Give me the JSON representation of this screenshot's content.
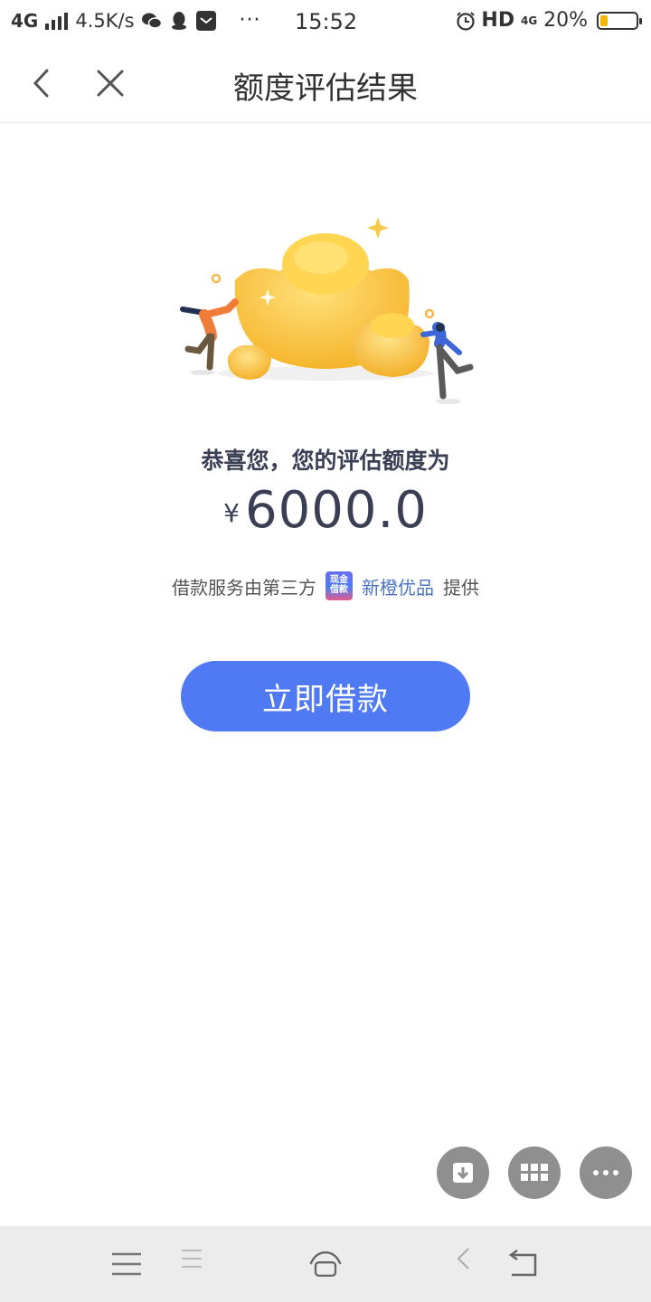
{
  "status_bar": {
    "network": "4G",
    "speed": "4.5K/s",
    "dots": "···",
    "time": "15:52",
    "hd": "HD",
    "net_small": "4G",
    "battery_text": "20%",
    "battery_level": 0.2
  },
  "nav": {
    "title": "额度评估结果"
  },
  "result": {
    "headline": "恭喜您，您的评估额度为",
    "currency": "¥",
    "amount": "6000.0"
  },
  "provider": {
    "prefix": "借款服务由第三方",
    "logo_text": "现金借款",
    "name": "新橙优品",
    "suffix": "提供"
  },
  "cta": {
    "label": "立即借款"
  },
  "colors": {
    "accent": "#4f7af3",
    "text_dark": "#3a3f55",
    "provider_link": "#4a73c9",
    "fab": "#8f8f8f"
  },
  "icons": [
    "back-icon",
    "close-icon",
    "download-icon",
    "grid-icon",
    "more-icon",
    "menu-icon",
    "home-icon",
    "back-nav-icon",
    "return-icon"
  ]
}
